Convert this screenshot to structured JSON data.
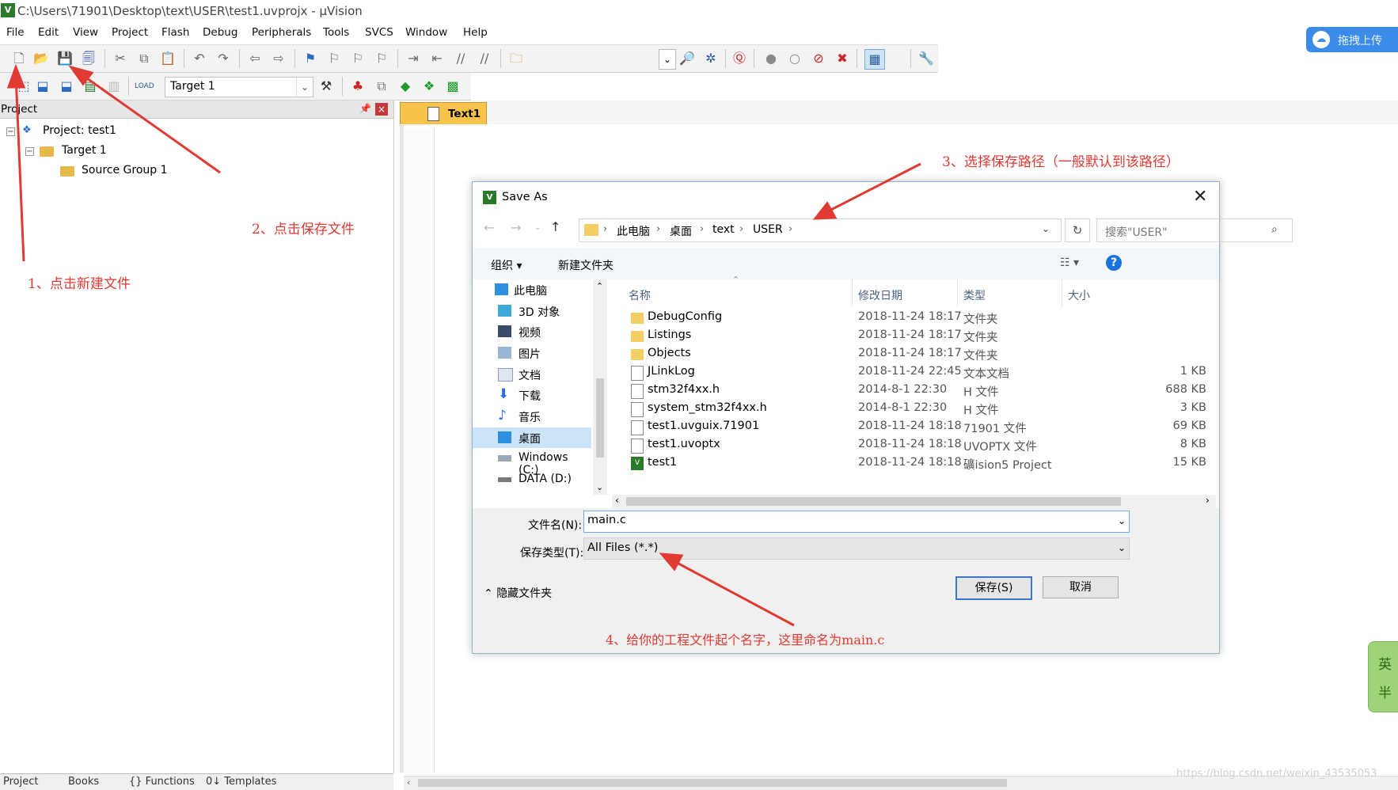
{
  "window": {
    "title": "C:\\Users\\71901\\Desktop\\text\\USER\\test1.uvprojx - µVision",
    "app_icon": "V"
  },
  "menu": [
    "File",
    "Edit",
    "View",
    "Project",
    "Flash",
    "Debug",
    "Peripherals",
    "Tools",
    "SVCS",
    "Window",
    "Help"
  ],
  "cloud": {
    "label": "拖拽上传",
    "icon": "baidu-cloud-icon"
  },
  "toolbar": {
    "target": "Target 1"
  },
  "project_panel": {
    "title": "Project",
    "pin": "ᵖ",
    "close": "×",
    "tree": {
      "project": "Project: test1",
      "target": "Target 1",
      "group": "Source Group 1"
    },
    "tabs": [
      "Project",
      "Books",
      "{} Functions",
      "0↓ Templates"
    ]
  },
  "editor": {
    "tab": "Text1"
  },
  "dialog": {
    "title": "Save As",
    "breadcrumb": [
      "此电脑",
      "桌面",
      "text",
      "USER"
    ],
    "search_placeholder": "搜索\"USER\"",
    "organize": "组织 ▾",
    "new_folder": "新建文件夹",
    "nav": [
      "此电脑",
      "3D 对象",
      "视频",
      "图片",
      "文档",
      "下载",
      "音乐",
      "桌面",
      "Windows (C:)",
      "DATA (D:)"
    ],
    "columns": [
      "名称",
      "修改日期",
      "类型",
      "大小"
    ],
    "files": [
      {
        "name": "DebugConfig",
        "date": "2018-11-24 18:17",
        "type": "文件夹",
        "size": "",
        "icon": "folder"
      },
      {
        "name": "Listings",
        "date": "2018-11-24 18:17",
        "type": "文件夹",
        "size": "",
        "icon": "folder"
      },
      {
        "name": "Objects",
        "date": "2018-11-24 18:17",
        "type": "文件夹",
        "size": "",
        "icon": "folder"
      },
      {
        "name": "JLinkLog",
        "date": "2018-11-24 22:45",
        "type": "文本文档",
        "size": "1 KB",
        "icon": "text"
      },
      {
        "name": "stm32f4xx.h",
        "date": "2014-8-1 22:30",
        "type": "H 文件",
        "size": "688 KB",
        "icon": "file"
      },
      {
        "name": "system_stm32f4xx.h",
        "date": "2014-8-1 22:30",
        "type": "H 文件",
        "size": "3 KB",
        "icon": "file"
      },
      {
        "name": "test1.uvguix.71901",
        "date": "2018-11-24 18:18",
        "type": "71901 文件",
        "size": "69 KB",
        "icon": "file"
      },
      {
        "name": "test1.uvoptx",
        "date": "2018-11-24 18:18",
        "type": "UVOPTX 文件",
        "size": "8 KB",
        "icon": "file"
      },
      {
        "name": "test1",
        "date": "2018-11-24 18:18",
        "type": "礦ision5 Project",
        "size": "15 KB",
        "icon": "uvision"
      }
    ],
    "filename_label": "文件名(N):",
    "filename": "main.c",
    "filetype_label": "保存类型(T):",
    "filetype": "All Files (*.*)",
    "hide_folders": "隐藏文件夹",
    "save": "保存(S)",
    "cancel": "取消"
  },
  "annotations": {
    "a1": "1、点击新建文件",
    "a2": "2、点击保存文件",
    "a3": "3、选择保存路径（一般默认到该路径）",
    "a4": "4、给你的工程文件起个名字，这里命名为main.c"
  },
  "ime": [
    "英",
    "半"
  ],
  "watermark": "https://blog.csdn.net/weixin_43535053",
  "colors": {
    "annotation": "#e03a33",
    "tab_active": "#f8c34a",
    "accent": "#3b79c8"
  }
}
